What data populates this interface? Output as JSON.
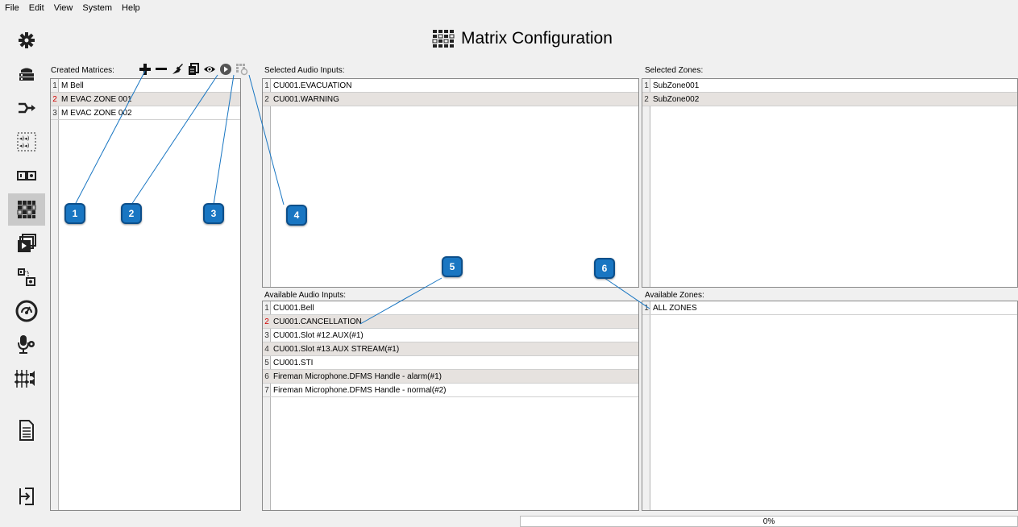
{
  "menu": [
    "File",
    "Edit",
    "View",
    "System",
    "Help"
  ],
  "sidebar": [
    {
      "icon": "gear-icon"
    },
    {
      "icon": "router-icon"
    },
    {
      "icon": "routing-arrow-icon"
    },
    {
      "icon": "speaker-zones-icon"
    },
    {
      "icon": "io-modules-icon"
    },
    {
      "icon": "matrix-grid-icon",
      "active": true
    },
    {
      "icon": "media-play-icon"
    },
    {
      "icon": "linked-devices-icon"
    },
    {
      "icon": "gauge-icon"
    },
    {
      "icon": "microphone-settings-icon"
    },
    {
      "icon": "mixer-icon"
    },
    {
      "icon": "document-icon"
    },
    {
      "icon": "logout-icon"
    }
  ],
  "title": "Matrix Configuration",
  "created_matrices": {
    "label": "Created Matrices:",
    "rows": [
      {
        "num": "1",
        "text": "M Bell",
        "red": false
      },
      {
        "num": "2",
        "text": "M EVAC ZONE 001",
        "red": true
      },
      {
        "num": "3",
        "text": "M EVAC ZONE 002",
        "red": false
      }
    ]
  },
  "selected_inputs": {
    "label": "Selected Audio Inputs:",
    "rows": [
      {
        "num": "1",
        "text": "CU001.EVACUATION",
        "red": false
      },
      {
        "num": "2",
        "text": "CU001.WARNING",
        "red": false
      }
    ]
  },
  "selected_zones": {
    "label": "Selected Zones:",
    "rows": [
      {
        "num": "1",
        "text": "SubZone001",
        "red": false
      },
      {
        "num": "2",
        "text": "SubZone002",
        "red": false
      }
    ]
  },
  "available_inputs": {
    "label": "Available Audio Inputs:",
    "rows": [
      {
        "num": "1",
        "text": "CU001.Bell",
        "red": false
      },
      {
        "num": "2",
        "text": "CU001.CANCELLATION",
        "red": true
      },
      {
        "num": "3",
        "text": "CU001.Slot #12.AUX(#1)",
        "red": false
      },
      {
        "num": "4",
        "text": "CU001.Slot #13.AUX STREAM(#1)",
        "red": false
      },
      {
        "num": "5",
        "text": "CU001.STI",
        "red": false
      },
      {
        "num": "6",
        "text": "Fireman Microphone.DFMS Handle - alarm(#1)",
        "red": false
      },
      {
        "num": "7",
        "text": "Fireman Microphone.DFMS Handle - normal(#2)",
        "red": false
      }
    ]
  },
  "available_zones": {
    "label": "Available Zones:",
    "rows": [
      {
        "num": "1",
        "text": "ALL ZONES",
        "red": false
      }
    ]
  },
  "toolbar": [
    "add-icon",
    "remove-icon",
    "clear-icon",
    "copy-icon",
    "view-icon",
    "play-icon",
    "matrix-settings-icon"
  ],
  "callouts": [
    "1",
    "2",
    "3",
    "4",
    "5",
    "6"
  ],
  "progress": {
    "text": "0%",
    "value": 0
  }
}
